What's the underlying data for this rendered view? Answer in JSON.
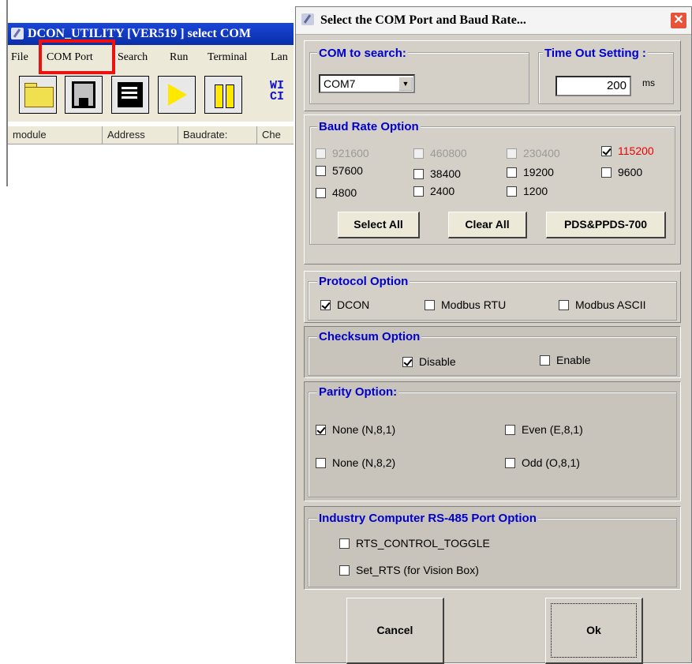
{
  "main": {
    "title": "DCON_UTILITY [VER519 ] select COM",
    "menu": [
      "File",
      "COM Port",
      "Search",
      "Run",
      "Terminal",
      "Lan"
    ],
    "toolbar_logo": "WI\nCI",
    "columns": [
      "module",
      "Address",
      "Baudrate:",
      "Che"
    ]
  },
  "dialog": {
    "title": "Select the COM Port and Baud Rate...",
    "close_glyph": "✕",
    "com_search": {
      "title": "COM to search:",
      "value": "COM7",
      "arrow": "▼"
    },
    "timeout": {
      "title": "Time Out Setting :",
      "value": "200",
      "unit": "ms"
    },
    "baud": {
      "title": "Baud Rate Option",
      "rates": [
        {
          "label": "921600",
          "checked": false,
          "state": "disabled"
        },
        {
          "label": "460800",
          "checked": false,
          "state": "disabled"
        },
        {
          "label": "230400",
          "checked": false,
          "state": "disabled"
        },
        {
          "label": "115200",
          "checked": true,
          "state": "highlight"
        },
        {
          "label": "57600",
          "checked": false,
          "state": "normal"
        },
        {
          "label": "38400",
          "checked": false,
          "state": "normal"
        },
        {
          "label": "19200",
          "checked": false,
          "state": "normal"
        },
        {
          "label": "9600",
          "checked": false,
          "state": "normal"
        },
        {
          "label": "4800",
          "checked": false,
          "state": "normal"
        },
        {
          "label": "2400",
          "checked": false,
          "state": "normal"
        },
        {
          "label": "1200",
          "checked": false,
          "state": "normal"
        }
      ],
      "select_all": "Select All",
      "clear_all": "Clear All",
      "pds": "PDS&PPDS-700"
    },
    "protocol": {
      "title": "Protocol Option",
      "options": [
        {
          "label": "DCON",
          "checked": true
        },
        {
          "label": "Modbus RTU",
          "checked": false
        },
        {
          "label": "Modbus ASCII",
          "checked": false
        }
      ]
    },
    "checksum": {
      "title": "Checksum  Option",
      "options": [
        {
          "label": "Disable",
          "checked": true
        },
        {
          "label": "Enable",
          "checked": false
        }
      ]
    },
    "parity": {
      "title": "Parity Option:",
      "options": [
        {
          "label": "None  (N,8,1)",
          "checked": true
        },
        {
          "label": "Even  (E,8,1)",
          "checked": false
        },
        {
          "label": "None (N,8,2)",
          "checked": false
        },
        {
          "label": "Odd  (O,8,1)",
          "checked": false
        }
      ]
    },
    "industry": {
      "title": "Industry Computer RS-485 Port Option",
      "options": [
        {
          "label": "RTS_CONTROL_TOGGLE",
          "checked": false
        },
        {
          "label": "Set_RTS (for Vision Box)",
          "checked": false
        }
      ]
    },
    "cancel": "Cancel",
    "ok": "Ok"
  },
  "colors": {
    "title_blue": "#0a2ea8",
    "group_title": "#0000cc",
    "highlight_red": "#ee0000",
    "menu_highlight_box": "#ee1111"
  }
}
